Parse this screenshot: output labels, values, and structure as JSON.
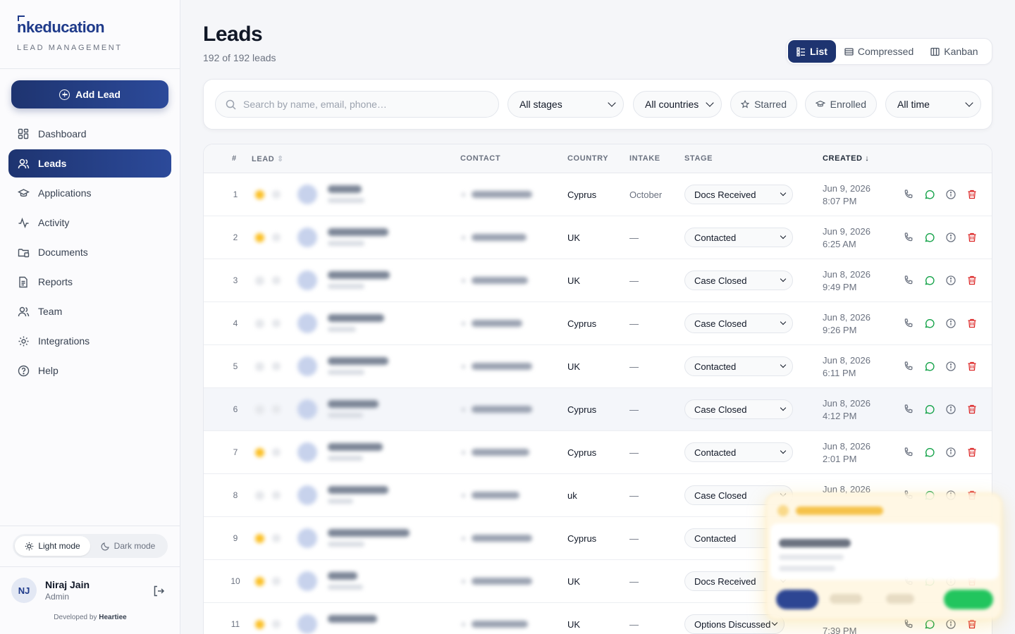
{
  "brand": {
    "logo_prefix": "nk",
    "logo_text": "education",
    "subtitle": "LEAD MANAGEMENT"
  },
  "sidebar": {
    "add_lead_label": "Add Lead",
    "items": [
      {
        "label": "Dashboard",
        "icon": "grid-icon"
      },
      {
        "label": "Leads",
        "icon": "users-icon",
        "active": true
      },
      {
        "label": "Applications",
        "icon": "graduation-cap-icon"
      },
      {
        "label": "Activity",
        "icon": "activity-icon"
      },
      {
        "label": "Documents",
        "icon": "folder-icon"
      },
      {
        "label": "Reports",
        "icon": "file-text-icon"
      },
      {
        "label": "Team",
        "icon": "team-icon"
      },
      {
        "label": "Integrations",
        "icon": "gear-icon"
      },
      {
        "label": "Help",
        "icon": "help-circle-icon"
      }
    ],
    "theme": {
      "light": "Light mode",
      "dark": "Dark mode",
      "selected": "light"
    },
    "user": {
      "initials": "NJ",
      "name": "Niraj Jain",
      "role": "Admin"
    },
    "developed_prefix": "Developed by",
    "developed_by": "Heartiee"
  },
  "header": {
    "title": "Leads",
    "subtitle": "192 of 192 leads"
  },
  "views": {
    "list": "List",
    "compressed": "Compressed",
    "kanban": "Kanban",
    "selected": "list"
  },
  "filters": {
    "search_placeholder": "Search by name, email, phone…",
    "stage": "All stages",
    "country": "All countries",
    "starred": "Starred",
    "enrolled": "Enrolled",
    "time": "All time"
  },
  "table": {
    "columns": {
      "num": "#",
      "lead": "LEAD",
      "contact": "CONTACT",
      "country": "COUNTRY",
      "intake": "INTAKE",
      "stage": "STAGE",
      "created": "CREATED"
    },
    "rows": [
      {
        "num": "1",
        "country": "Cyprus",
        "intake": "October",
        "stage": "Docs Received",
        "date": "Jun 9, 2026",
        "time": "8:07 PM",
        "starred": true
      },
      {
        "num": "2",
        "country": "UK",
        "intake": "—",
        "stage": "Contacted",
        "date": "Jun 9, 2026",
        "time": "6:25 AM",
        "starred": true
      },
      {
        "num": "3",
        "country": "UK",
        "intake": "—",
        "stage": "Case Closed",
        "date": "Jun 8, 2026",
        "time": "9:49 PM",
        "starred": false
      },
      {
        "num": "4",
        "country": "Cyprus",
        "intake": "—",
        "stage": "Case Closed",
        "date": "Jun 8, 2026",
        "time": "9:26 PM",
        "starred": false
      },
      {
        "num": "5",
        "country": "UK",
        "intake": "—",
        "stage": "Contacted",
        "date": "Jun 8, 2026",
        "time": "6:11 PM",
        "starred": false
      },
      {
        "num": "6",
        "country": "Cyprus",
        "intake": "—",
        "stage": "Case Closed",
        "date": "Jun 8, 2026",
        "time": "4:12 PM",
        "starred": false
      },
      {
        "num": "7",
        "country": "Cyprus",
        "intake": "—",
        "stage": "Contacted",
        "date": "Jun 8, 2026",
        "time": "2:01 PM",
        "starred": true
      },
      {
        "num": "8",
        "country": "uk",
        "intake": "—",
        "stage": "Case Closed",
        "date": "Jun 8, 2026",
        "time": "",
        "starred": false
      },
      {
        "num": "9",
        "country": "Cyprus",
        "intake": "—",
        "stage": "Contacted",
        "date": "",
        "time": "",
        "starred": true
      },
      {
        "num": "10",
        "country": "UK",
        "intake": "—",
        "stage": "Docs Received",
        "date": "",
        "time": "",
        "starred": true
      },
      {
        "num": "11",
        "country": "UK",
        "intake": "—",
        "stage": "Options Discussed",
        "date": "",
        "time": "7:39 PM",
        "starred": true
      }
    ]
  },
  "colors": {
    "primary": "#1e3470",
    "accent_green": "#16a34a",
    "danger": "#dc2626",
    "star": "#fbbf24"
  }
}
